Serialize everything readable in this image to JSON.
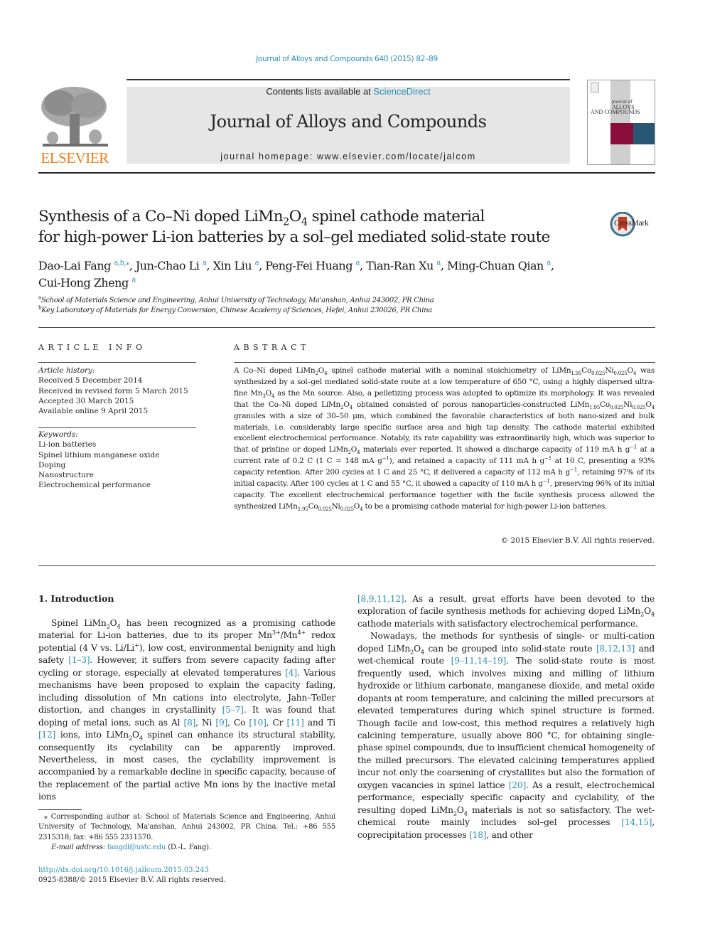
{
  "citation": "Journal of Alloys and Compounds 640 (2015) 82–89",
  "header": {
    "publisher": "ELSEVIER",
    "contents_prefix": "Contents lists available at ",
    "contents_link": "ScienceDirect",
    "journal_title": "Journal of Alloys and Compounds",
    "homepage_prefix": "journal homepage: ",
    "homepage_url": "www.elsevier.com/locate/jalcom",
    "cover": {
      "line1": "Journal of",
      "line2": "ALLOYS",
      "line3": "AND COMPOUNDS",
      "accent_red": "#8b0e3a",
      "accent_blue": "#285775"
    }
  },
  "article": {
    "title_line1_a": "Synthesis of a Co–Ni doped LiMn",
    "title_line1_sub1": "2",
    "title_line1_b": "O",
    "title_line1_sub2": "4",
    "title_line1_c": " spinel cathode material",
    "title_line2": "for high-power Li-ion batteries by a sol–gel mediated solid-state route",
    "crossmark_label": "CrossMark",
    "authors": [
      {
        "name": "Dao-Lai Fang",
        "sup": "a,b,⁎",
        "sep": ", "
      },
      {
        "name": "Jun-Chao Li",
        "sup": "a",
        "sep": ", "
      },
      {
        "name": "Xin Liu",
        "sup": "a",
        "sep": ", "
      },
      {
        "name": "Peng-Fei Huang",
        "sup": "a",
        "sep": ", "
      },
      {
        "name": "Tian-Ran Xu",
        "sup": "a",
        "sep": ", "
      },
      {
        "name": "Ming-Chuan Qian",
        "sup": "a",
        "sep": ","
      },
      {
        "name": "Cui-Hong Zheng",
        "sup": "a",
        "sep": ""
      }
    ],
    "affiliations": [
      {
        "mark": "a",
        "text": "School of Materials Science and Engineering, Anhui University of Technology, Ma'anshan, Anhui 243002, PR China"
      },
      {
        "mark": "b",
        "text": "Key Laboratory of Materials for Energy Conversion, Chinese Academy of Sciences, Hefei, Anhui 230026, PR China"
      }
    ]
  },
  "article_info": {
    "heading": "ARTICLE INFO",
    "history_label": "Article history:",
    "history": [
      "Received 5 December 2014",
      "Received in revised form 5 March 2015",
      "Accepted 30 March 2015",
      "Available online 9 April 2015"
    ],
    "keywords_label": "Keywords:",
    "keywords": [
      "Li-ion batteries",
      "Spinel lithium manganese oxide",
      "Doping",
      "Nanostructure",
      "Electrochemical performance"
    ]
  },
  "abstract": {
    "heading": "ABSTRACT",
    "html_text": "A Co–Ni doped LiMn<sub>2</sub>O<sub>4</sub> spinel cathode material with a nominal stoichiometry of LiMn<sub>1.95</sub>Co<sub>0.025</sub>Ni<sub>0.025</sub>O<sub>4</sub> was synthesized by a sol–gel mediated solid-state route at a low temperature of 650 °C, using a highly dispersed ultra-fine Mn<sub>3</sub>O<sub>4</sub> as the Mn source. Also, a pelletizing process was adopted to optimize its morphology. It was revealed that the Co–Ni doped LiMn<sub>2</sub>O<sub>4</sub> obtained consisted of porous nanoparticles-constructed LiMn<sub>1.95</sub>Co<sub>0.025</sub>Ni<sub>0.025</sub>O<sub>4</sub> granules with a size of 30–50 μm, which combined the favorable characteristics of both nano-sized and bulk materials, i.e. considerably large specific surface area and high tap density. The cathode material exhibited excellent electrochemical performance. Notably, its rate capability was extraordinarily high, which was superior to that of pristine or doped LiMn<sub>2</sub>O<sub>4</sub> materials ever reported. It showed a discharge capacity of 119 mA h g<sup>−1</sup> at a current rate of 0.2 C (1 C = 148 mA g<sup>−1</sup>), and retained a capacity of 111 mA h g<sup>−1</sup> at 10 C, presenting a 93% capacity retention. After 200 cycles at 1 C and 25 °C, it delivered a capacity of 112 mA h g<sup>−1</sup>, retaining 97% of its initial capacity. After 100 cycles at 1 C and 55 °C, it showed a capacity of 110 mA h g<sup>−1</sup>, preserving 96% of its initial capacity. The excellent electrochemical performance together with the facile synthesis process allowed the synthesized LiMn<sub>1.95</sub>Co<sub>0.025</sub>Ni<sub>0.025</sub>O<sub>4</sub> to be a promising cathode material for high-power Li-ion batteries.",
    "copyright": "© 2015 Elsevier B.V. All rights reserved."
  },
  "body": {
    "section_heading": "1. Introduction",
    "left_html": "Spinel LiMn<sub>2</sub>O<sub>4</sub> has been recognized as a promising cathode material for Li-ion batteries, due to its proper Mn<sup>3+</sup>/Mn<sup>4+</sup> redox potential (4 V vs. Li/Li<sup>+</sup>), low cost, environmental benignity and high safety <a class=\"link\">[1–3]</a>. However, it suffers from severe capacity fading after cycling or storage, especially at elevated temperatures <a class=\"link\">[4]</a>. Various mechanisms have been proposed to explain the capacity fading, including dissolution of Mn cations into electrolyte, Jahn–Teller distortion, and changes in crystallinity <a class=\"link\">[5–7]</a>. It was found that doping of metal ions, such as Al <a class=\"link\">[8]</a>, Ni <a class=\"link\">[9]</a>, Co <a class=\"link\">[10]</a>, Cr <a class=\"link\">[11]</a> and Ti <a class=\"link\">[12]</a> ions, into LiMn<sub>2</sub>O<sub>4</sub> spinel can enhance its structural stability, consequently its cyclability can be apparently improved. Nevertheless, in most cases, the cyclability improvement is accompanied by a remarkable decline in specific capacity, because of the replacement of the partial active Mn ions by the inactive metal ions",
    "right_p1_html": "<a class=\"link\">[8,9,11,12]</a>. As a result, great efforts have been devoted to the exploration of facile synthesis methods for achieving doped LiMn<sub>2</sub>O<sub>4</sub> cathode materials with satisfactory electrochemical performance.",
    "right_p2_html": "Nowadays, the methods for synthesis of single- or multi-cation doped LiMn<sub>2</sub>O<sub>4</sub> can be grouped into solid-state route <a class=\"link\">[8,12,13]</a> and wet-chemical route <a class=\"link\">[9–11,14–19]</a>. The solid-state route is most frequently used, which involves mixing and milling of lithium hydroxide or lithium carbonate, manganese dioxide, and metal oxide dopants at room temperature, and calcining the milled precursors at elevated temperatures during which spinel structure is formed. Though facile and low-cost, this method requires a relatively high calcining temperature, usually above 800 °C, for obtaining single-phase spinel compounds, due to insufficient chemical homogeneity of the milled precursors. The elevated calcining temperatures applied incur not only the coarsening of crystallites but also the formation of oxygen vacancies in spinel lattice <a class=\"link\">[20]</a>. As a result, electrochemical performance, especially specific capacity and cyclability, of the resulting doped LiMn<sub>2</sub>O<sub>4</sub> materials is not so satisfactory. The wet-chemical route mainly includes sol–gel processes <a class=\"link\">[14,15]</a>, coprecipitation processes <a class=\"link\">[18]</a>, and other"
  },
  "footnotes": {
    "corresponding": "⁎ Corresponding author at: School of Materials Science and Engineering, Anhui University of Technology, Ma'anshan, Anhui 243002, PR China. Tel.: +86 555 2315318; fax: +86 555 2311570.",
    "email_label": "E-mail address: ",
    "email": "fangdl@ustc.edu",
    "email_suffix": " (D.-L. Fang).",
    "doi": "http://dx.doi.org/10.1016/j.jallcom.2015.03.243",
    "issn_line": "0925-8388/© 2015 Elsevier B.V. All rights reserved."
  },
  "colors": {
    "link": "#2a8fb8",
    "elsevier_orange": "#f07e1b",
    "header_gray": "#e6e6e6"
  }
}
